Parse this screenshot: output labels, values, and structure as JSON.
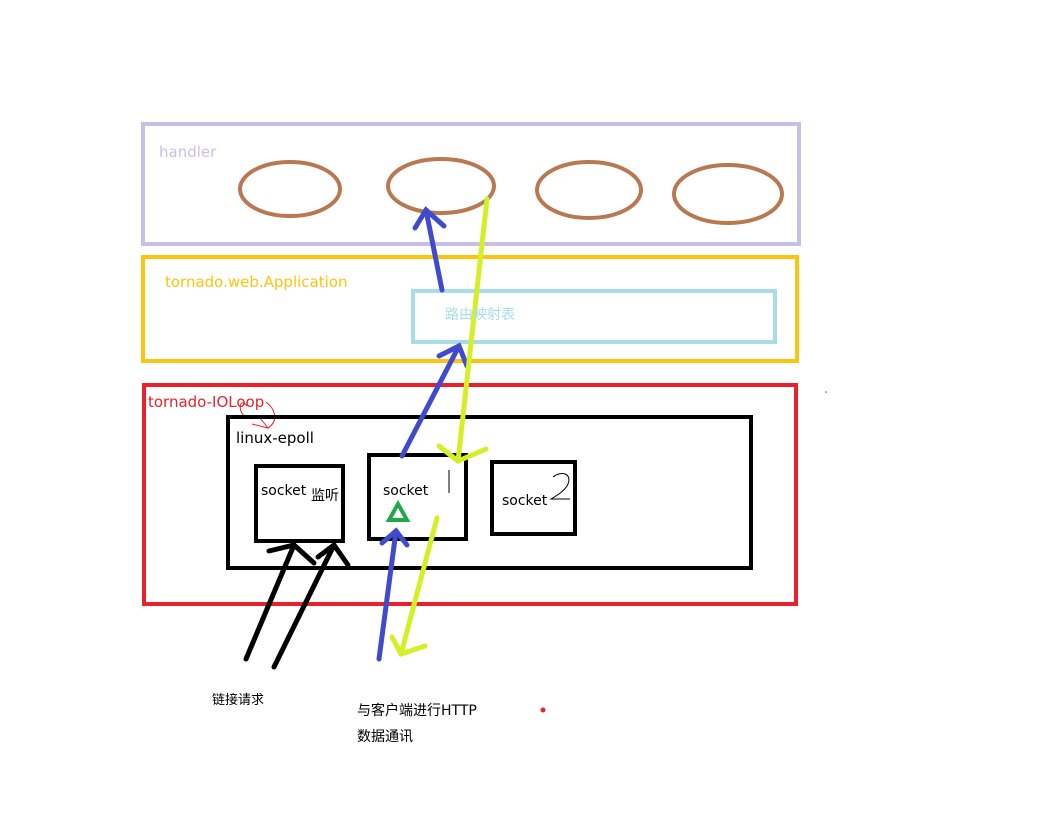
{
  "colors": {
    "handler": "#c8c0e4",
    "application": "#fcc40e",
    "route_table": "#a8dce8",
    "ioloop": "#e8212b",
    "epoll": "#000000",
    "ellipse": "#b87850",
    "blue_arrow": "#3f4acc",
    "lime_arrow": "#d4f024",
    "green_marker": "#22a84a"
  },
  "icons": [
    "arrow-up-icon",
    "arrow-down-icon",
    "green-triangle-icon",
    "red-dot-icon"
  ],
  "handler_layer": {
    "label": "handler",
    "handler_count": 4
  },
  "application_layer": {
    "label": "tornado.web.Application",
    "route_table_label": "路由映射表"
  },
  "ioloop_layer": {
    "label": "tornado-IOLoop",
    "epoll_label": "linux-epoll"
  },
  "sockets": [
    {
      "label": "socket",
      "note": "监听"
    },
    {
      "label": "socket",
      "note": "1"
    },
    {
      "label": "socket",
      "note": "2"
    }
  ],
  "annotations": {
    "connection_requests": "链接请求",
    "client_http_line1": "与客户端进行HTTP",
    "client_http_line2": "数据通讯"
  }
}
